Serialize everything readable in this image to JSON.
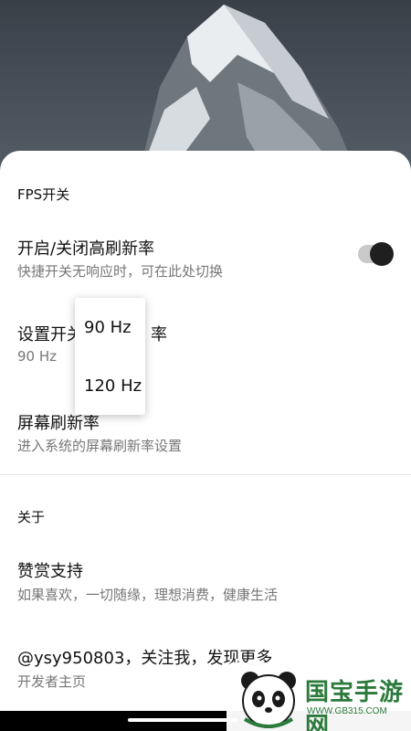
{
  "fps_section": {
    "header": "FPS开关",
    "toggle_row": {
      "title": "开启/关闭高刷新率",
      "subtitle": "快捷开关无响应时，可在此处切换",
      "enabled": true
    },
    "set_switch_row": {
      "title_visible": "设置开关",
      "title_tail": "率",
      "value": "90 Hz"
    },
    "screen_refresh_row": {
      "title": "屏幕刷新率",
      "subtitle": "进入系统的屏幕刷新率设置"
    }
  },
  "popup": {
    "options": [
      "90 Hz",
      "120 Hz"
    ]
  },
  "about_section": {
    "header": "关于",
    "donate_row": {
      "title": "赞赏支持",
      "subtitle": "如果喜欢，一切随缘，理想消费，健康生活"
    },
    "author_row": {
      "title": "@ysy950803，关注我，发现更多",
      "subtitle": "开发者主页"
    }
  },
  "watermark": {
    "text": "国宝手游网",
    "url": "WWW.GB315.COM"
  },
  "colors": {
    "accent": "#2b7a3b",
    "toggle_knob": "#1f1f1f"
  }
}
